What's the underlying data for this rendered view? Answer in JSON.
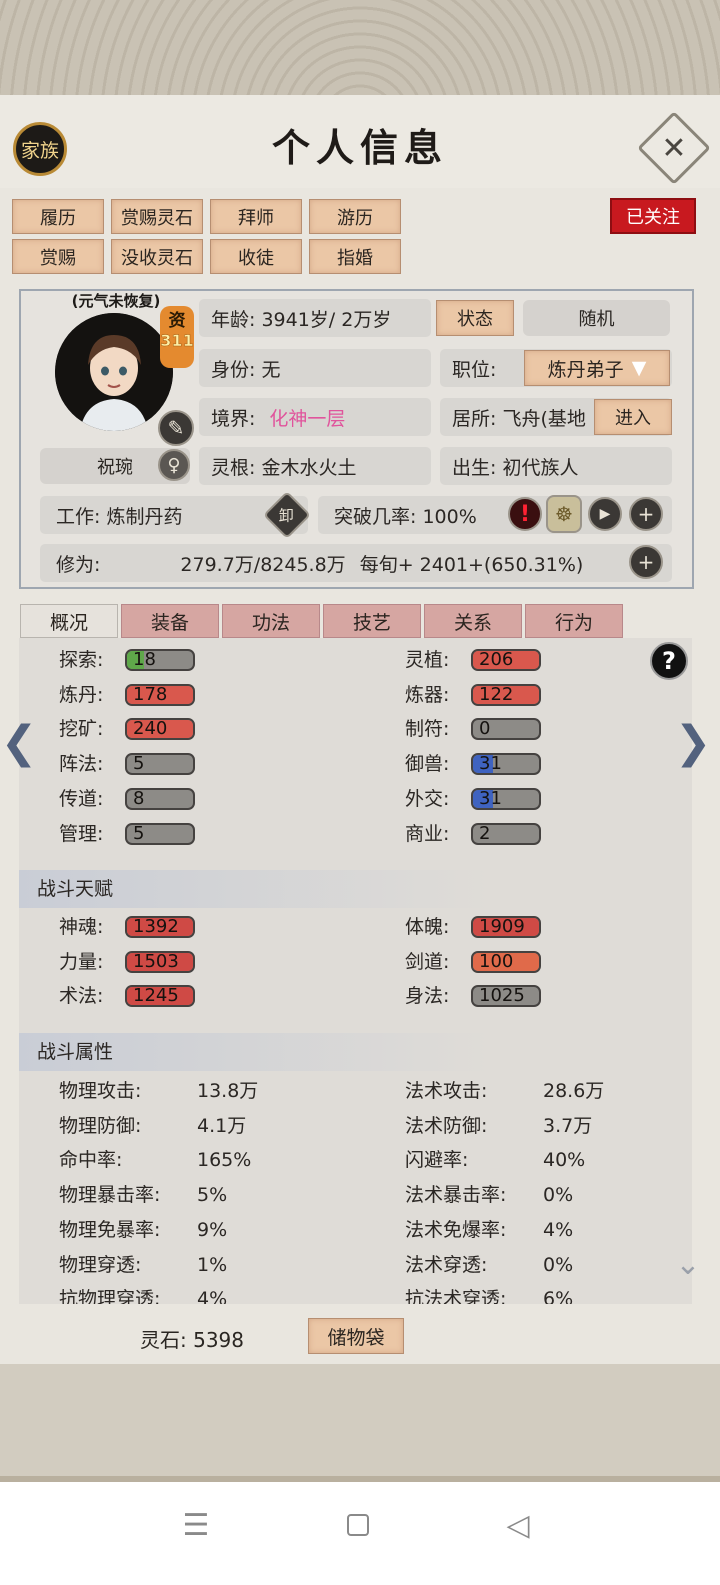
{
  "header": {
    "clan_label": "家族",
    "title": "个人信息"
  },
  "actions_row1": [
    "履历",
    "赏赐灵石",
    "拜师",
    "游历"
  ],
  "actions_row2": [
    "赏赐",
    "没收灵石",
    "收徒",
    "指婚"
  ],
  "follow_label": "已关注",
  "profile": {
    "avatar_status": "(元气未恢复)",
    "aptitude_label": "资",
    "aptitude_value": "311",
    "name": "祝琬",
    "age": "年龄: 3941岁/ 2万岁",
    "state_btn": "状态",
    "random_btn": "随机",
    "identity": "身份:   无",
    "position_label": "职位:",
    "position_value": "炼丹弟子",
    "realm_label": "境界:",
    "realm_value": "化神一层",
    "residence": "居所: 飞舟(基地",
    "enter_btn": "进入",
    "root": "灵根:   金木水火土",
    "birth": "出生:   初代族人",
    "work": "工作: 炼制丹药",
    "work_badge": "卸",
    "breakthrough": "突破几率:   100%",
    "cultivation_label": "修为:",
    "cultivation_value": "279.7万/8245.8万",
    "cultivation_rate": "每旬+  2401+(650.31%)"
  },
  "tabs": [
    "概况",
    "装备",
    "功法",
    "技艺",
    "关系",
    "行为"
  ],
  "skills_left": [
    {
      "label": "探索:",
      "value": "18",
      "fill": 0.25,
      "color": "#5fa84a"
    },
    {
      "label": "炼丹:",
      "value": "178",
      "fill": 1.0,
      "color": "#d9584d"
    },
    {
      "label": "挖矿:",
      "value": "240",
      "fill": 1.0,
      "color": "#d9584d"
    },
    {
      "label": "阵法:",
      "value": "5",
      "fill": 0,
      "color": "#8d8b87"
    },
    {
      "label": "传道:",
      "value": "8",
      "fill": 0,
      "color": "#8d8b87"
    },
    {
      "label": "管理:",
      "value": "5",
      "fill": 0,
      "color": "#8d8b87"
    }
  ],
  "skills_right": [
    {
      "label": "灵植:",
      "value": "206",
      "fill": 1.0,
      "color": "#d9584d"
    },
    {
      "label": "炼器:",
      "value": "122",
      "fill": 1.0,
      "color": "#d9584d"
    },
    {
      "label": "制符:",
      "value": "0",
      "fill": 0,
      "color": "#8d8b87"
    },
    {
      "label": "御兽:",
      "value": "31",
      "fill": 0.3,
      "color": "#3f63c0"
    },
    {
      "label": "外交:",
      "value": "31",
      "fill": 0.3,
      "color": "#3f63c0"
    },
    {
      "label": "商业:",
      "value": "2",
      "fill": 0,
      "color": "#8d8b87"
    }
  ],
  "talent_title": "战斗天赋",
  "talents_left": [
    {
      "label": "神魂:",
      "value": "1392",
      "fill": 1.0,
      "color": "#cf4a45"
    },
    {
      "label": "力量:",
      "value": "1503",
      "fill": 1.0,
      "color": "#cf4a45"
    },
    {
      "label": "术法:",
      "value": "1245",
      "fill": 1.0,
      "color": "#cf4a45"
    }
  ],
  "talents_right": [
    {
      "label": "体魄:",
      "value": "1909",
      "fill": 1.0,
      "color": "#cf4a45"
    },
    {
      "label": "剑道:",
      "value": "100",
      "fill": 1.0,
      "color": "#e06a4a"
    },
    {
      "label": "身法:",
      "value": "1025",
      "fill": 0,
      "color": "#8d8b87"
    }
  ],
  "attr_title": "战斗属性",
  "attrs_left": [
    {
      "label": "物理攻击:",
      "value": "13.8万"
    },
    {
      "label": "物理防御:",
      "value": "4.1万"
    },
    {
      "label": "命中率:",
      "value": "165%"
    },
    {
      "label": "物理暴击率:",
      "value": "5%"
    },
    {
      "label": "物理免暴率:",
      "value": "9%"
    },
    {
      "label": "物理穿透:",
      "value": "1%"
    },
    {
      "label": "抗物理穿透:",
      "value": "4%"
    }
  ],
  "attrs_right": [
    {
      "label": "法术攻击:",
      "value": "28.6万"
    },
    {
      "label": "法术防御:",
      "value": "3.7万"
    },
    {
      "label": "闪避率:",
      "value": "40%"
    },
    {
      "label": "法术暴击率:",
      "value": "0%"
    },
    {
      "label": "法术免爆率:",
      "value": "4%"
    },
    {
      "label": "法术穿透:",
      "value": "0%"
    },
    {
      "label": "抗法术穿透:",
      "value": "6%"
    }
  ],
  "footer": {
    "spirit_stones": "灵石: 5398",
    "bag_btn": "储物袋"
  },
  "help_symbol": "?"
}
